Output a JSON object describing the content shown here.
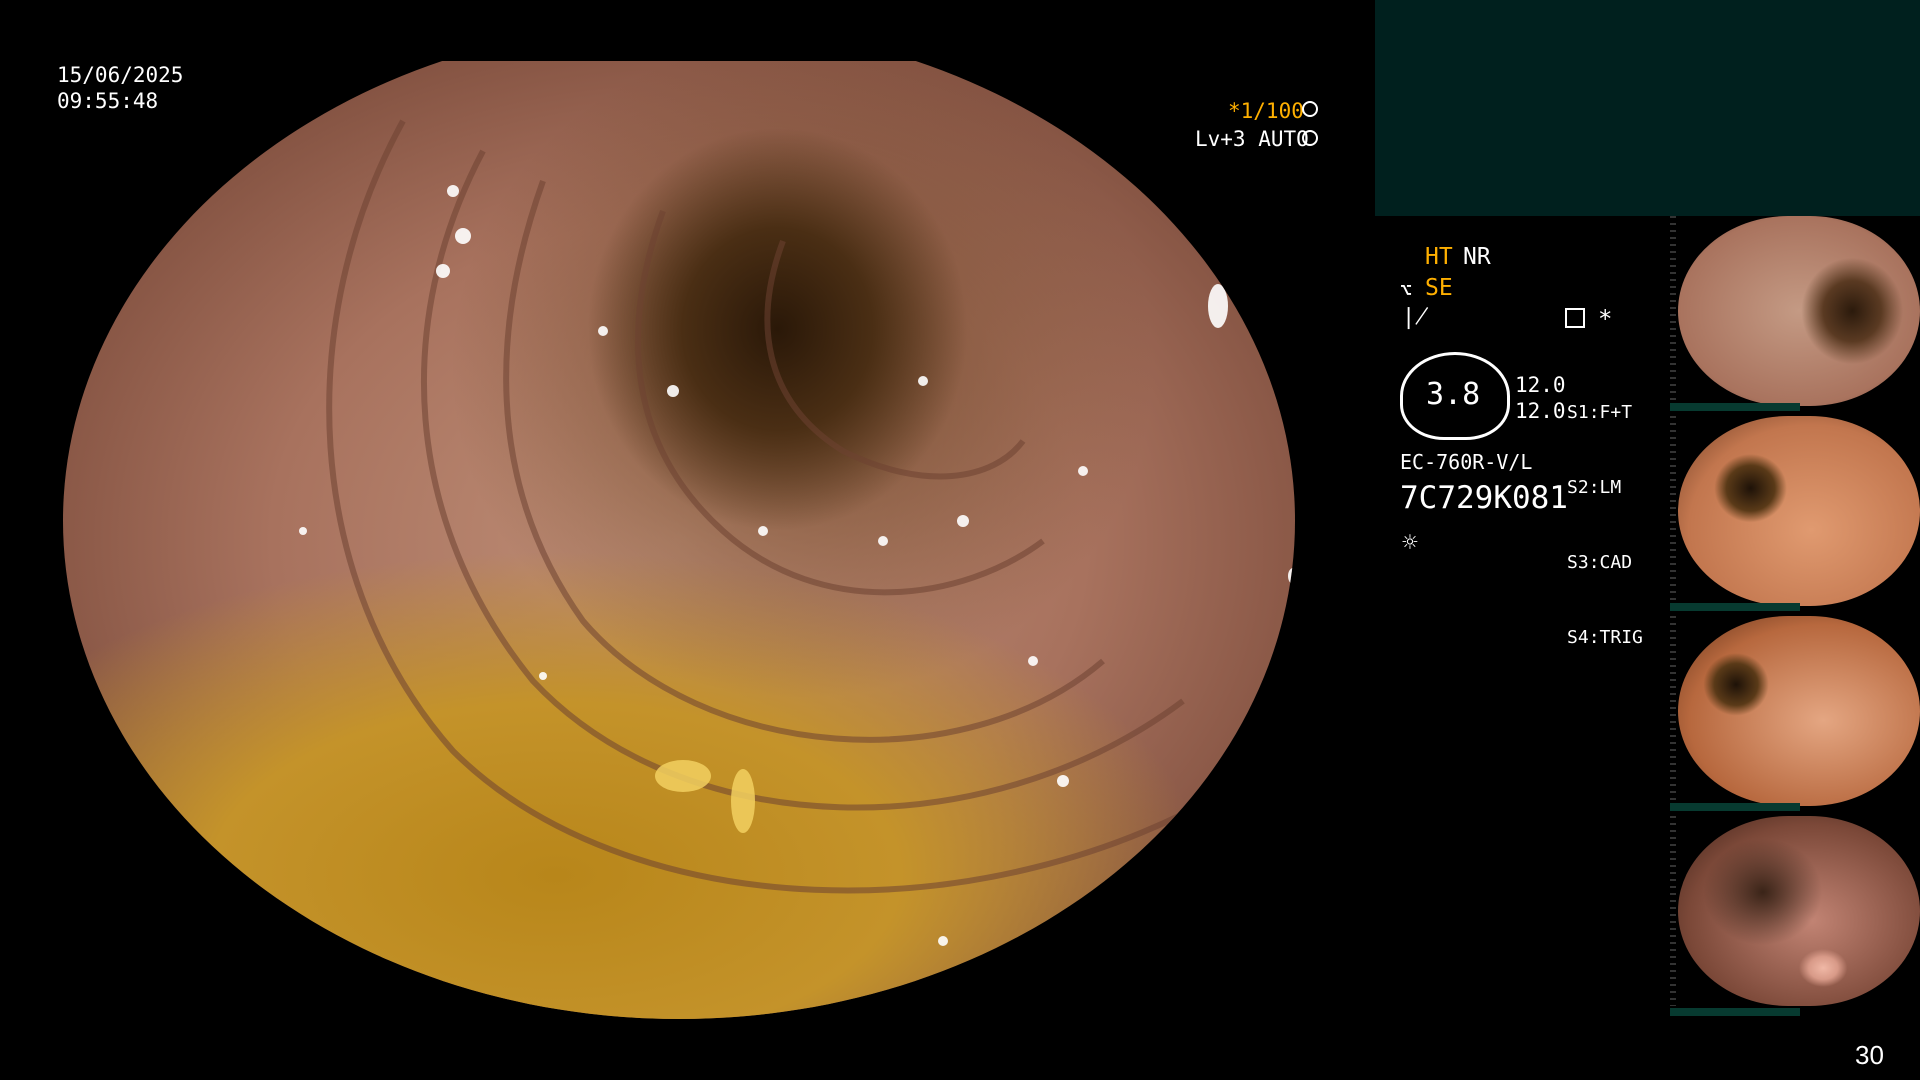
{
  "overlay": {
    "date": "15/06/2025",
    "time": "09:55:48",
    "shutter": "*1/100",
    "level": "Lv+3 AUTO"
  },
  "panel": {
    "ht": "HT",
    "nr": "NR",
    "se": "SE",
    "asterisk": "*",
    "zoom": "3.8",
    "value1": "12.0",
    "value2": "12.0",
    "switches": [
      {
        "key": "S1",
        "label": "F+T"
      },
      {
        "key": "S2",
        "label": "LM"
      },
      {
        "key": "S3",
        "label": "CAD"
      },
      {
        "key": "S4",
        "label": "TRIG"
      }
    ],
    "scope_model": "EC-760R-V/L",
    "serial": "7C729K081",
    "accent_color": "#ffb000",
    "icons": [
      "fan-icon",
      "aperture-icon",
      "scope-icon",
      "tilde-icon",
      "memory-icon",
      "sun-icon"
    ]
  },
  "thumbnails": [
    {
      "name": "thumbnail-1",
      "tint": "#a9735e"
    },
    {
      "name": "thumbnail-2",
      "tint": "#c2764e"
    },
    {
      "name": "thumbnail-3",
      "tint": "#b7683e"
    },
    {
      "name": "thumbnail-4",
      "tint": "#7b4838"
    }
  ],
  "page_number": "30"
}
